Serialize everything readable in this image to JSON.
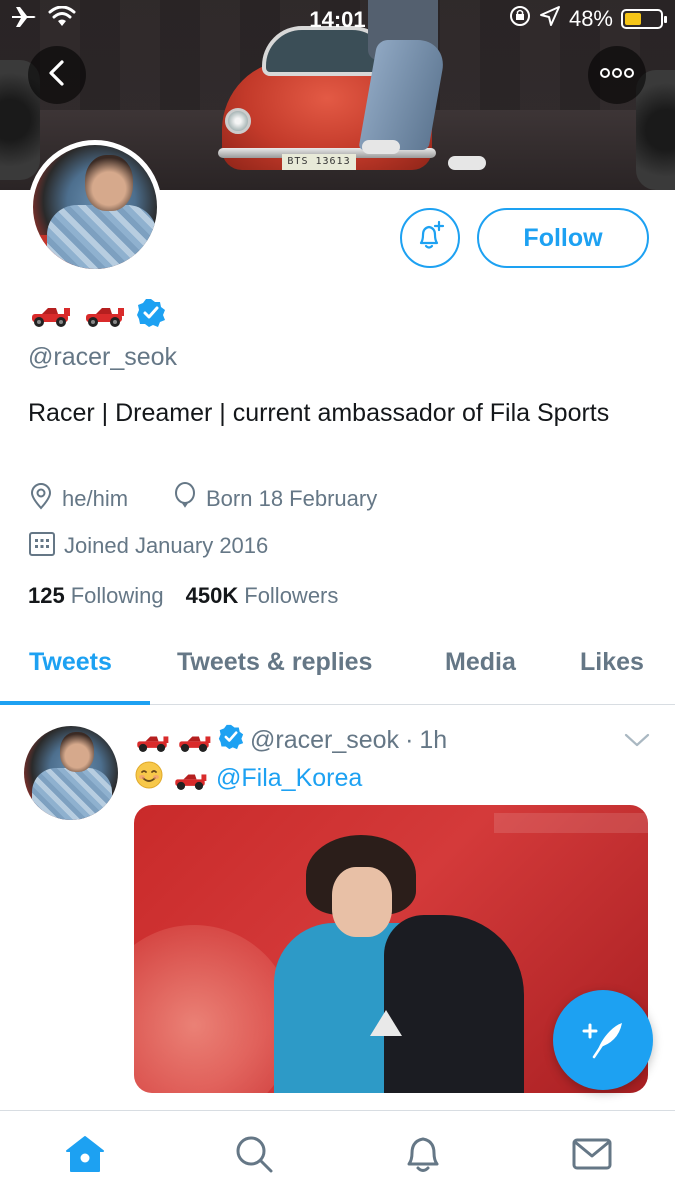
{
  "status_bar": {
    "time": "14:01",
    "battery_text": "48%",
    "battery_level": 0.48,
    "icons": [
      "airplane-icon",
      "wifi-icon",
      "orientation-lock-icon",
      "location-arrow-icon",
      "battery-icon"
    ]
  },
  "header": {
    "back_icon": "chevron-left-icon",
    "more_icon": "more-dots-icon",
    "banner_plate": "BTS 13613"
  },
  "profile": {
    "display_name_emoji": [
      "racing-car",
      "racing-car"
    ],
    "verified": true,
    "handle": "@racer_seok",
    "bio": "Racer | Dreamer | current ambassador of Fila Sports",
    "pronouns": "he/him",
    "birthday": "Born 18 February",
    "joined": "Joined January 2016",
    "following_count": "125",
    "following_label": "Following",
    "followers_count": "450K",
    "followers_label": "Followers"
  },
  "actions": {
    "follow_label": "Follow",
    "notify_icon": "bell-plus-icon"
  },
  "tabs": [
    {
      "label": "Tweets",
      "active": true
    },
    {
      "label": "Tweets & replies",
      "active": false
    },
    {
      "label": "Media",
      "active": false
    },
    {
      "label": "Likes",
      "active": false
    }
  ],
  "tweet": {
    "handle": "@racer_seok",
    "separator": "·",
    "time": "1h",
    "text_emoji": "☺",
    "mention": "@Fila_Korea"
  },
  "bottom_nav": [
    "home-icon",
    "search-icon",
    "notifications-icon",
    "messages-icon"
  ],
  "colors": {
    "accent": "#1da1f2",
    "text_primary": "#14171a",
    "text_secondary": "#657786",
    "car_red": "#c3342b"
  }
}
